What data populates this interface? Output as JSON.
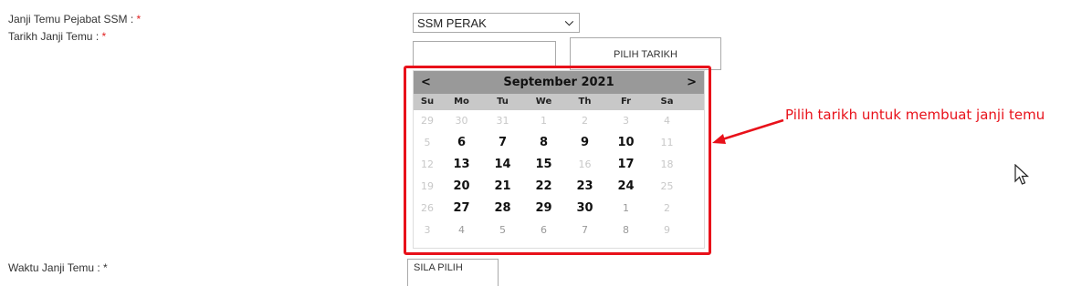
{
  "form": {
    "office_label": "Janji Temu Pejabat SSM : ",
    "date_label": "Tarikh Janji Temu : ",
    "required_mark": "*",
    "office_value": "SSM PERAK",
    "date_value": "",
    "pick_date_button": "PILIH TARIKH",
    "time_label_partial": "Waktu Janji Temu : *",
    "time_button_partial": "SILA PILIH"
  },
  "calendar": {
    "month_year": "September 2021",
    "prev": "<",
    "next": ">",
    "weekdays": [
      "Su",
      "Mo",
      "Tu",
      "We",
      "Th",
      "Fr",
      "Sa"
    ],
    "weeks": [
      [
        {
          "d": "29",
          "s": "muted"
        },
        {
          "d": "30",
          "s": "muted"
        },
        {
          "d": "31",
          "s": "muted"
        },
        {
          "d": "1",
          "s": "muted"
        },
        {
          "d": "2",
          "s": "muted"
        },
        {
          "d": "3",
          "s": "muted"
        },
        {
          "d": "4",
          "s": "muted"
        }
      ],
      [
        {
          "d": "5",
          "s": "muted"
        },
        {
          "d": "6",
          "s": "on"
        },
        {
          "d": "7",
          "s": "on"
        },
        {
          "d": "8",
          "s": "on"
        },
        {
          "d": "9",
          "s": "on"
        },
        {
          "d": "10",
          "s": "on"
        },
        {
          "d": "11",
          "s": "muted"
        }
      ],
      [
        {
          "d": "12",
          "s": "muted"
        },
        {
          "d": "13",
          "s": "on"
        },
        {
          "d": "14",
          "s": "on"
        },
        {
          "d": "15",
          "s": "on"
        },
        {
          "d": "16",
          "s": "muted"
        },
        {
          "d": "17",
          "s": "on"
        },
        {
          "d": "18",
          "s": "muted"
        }
      ],
      [
        {
          "d": "19",
          "s": "muted"
        },
        {
          "d": "20",
          "s": "on"
        },
        {
          "d": "21",
          "s": "on"
        },
        {
          "d": "22",
          "s": "on"
        },
        {
          "d": "23",
          "s": "on"
        },
        {
          "d": "24",
          "s": "on"
        },
        {
          "d": "25",
          "s": "muted"
        }
      ],
      [
        {
          "d": "26",
          "s": "muted"
        },
        {
          "d": "27",
          "s": "on"
        },
        {
          "d": "28",
          "s": "on"
        },
        {
          "d": "29",
          "s": "on"
        },
        {
          "d": "30",
          "s": "on"
        },
        {
          "d": "1",
          "s": "next"
        },
        {
          "d": "2",
          "s": "muted"
        }
      ],
      [
        {
          "d": "3",
          "s": "muted"
        },
        {
          "d": "4",
          "s": "next"
        },
        {
          "d": "5",
          "s": "next"
        },
        {
          "d": "6",
          "s": "next"
        },
        {
          "d": "7",
          "s": "next"
        },
        {
          "d": "8",
          "s": "next"
        },
        {
          "d": "9",
          "s": "muted"
        }
      ]
    ]
  },
  "annotation": {
    "text": "Pilih tarikh untuk membuat janji temu",
    "color": "#e8111a"
  },
  "icons": {
    "dropdown": "chevron-down-icon",
    "pointer": "mouse-cursor-icon",
    "callout": "arrow-icon"
  }
}
